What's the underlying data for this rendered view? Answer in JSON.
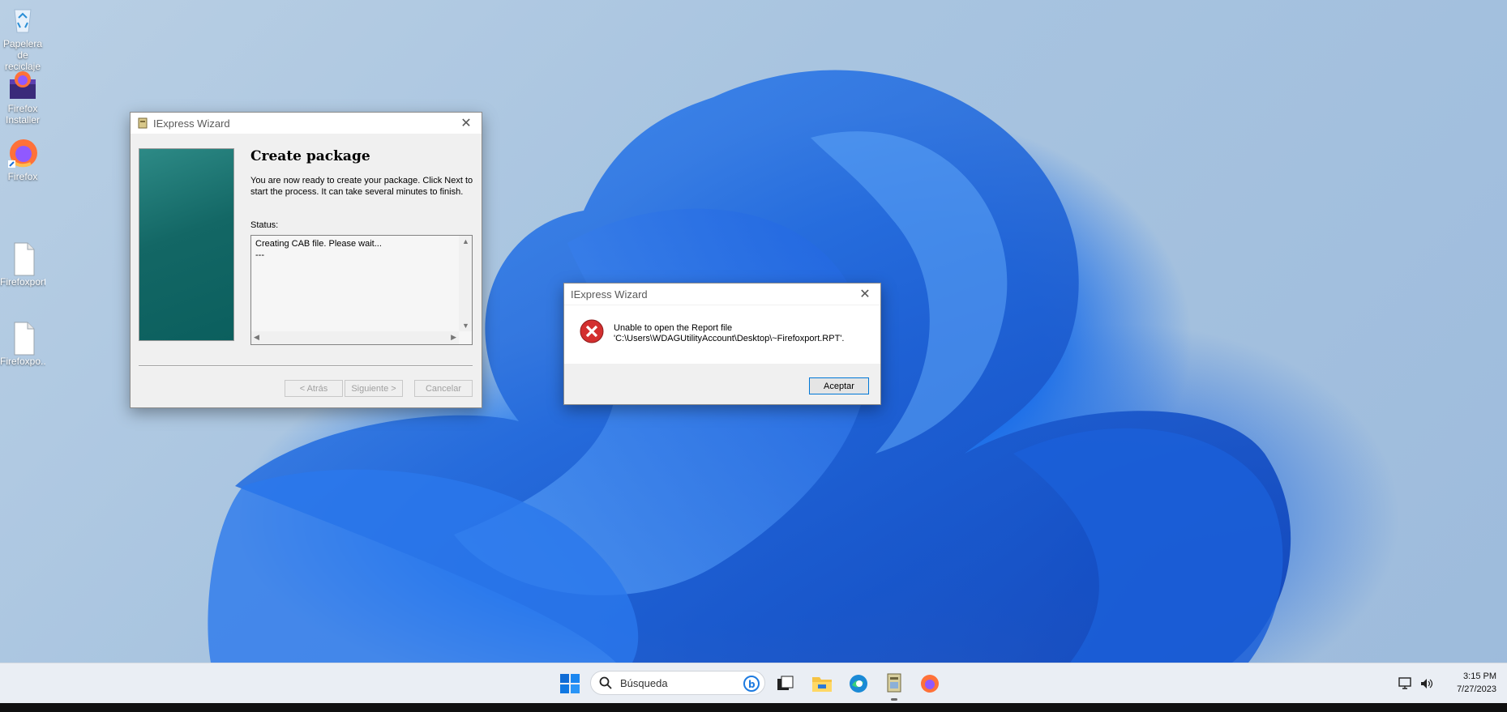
{
  "desktop": {
    "icons": [
      {
        "label": "Papelera de reciclaje"
      },
      {
        "label": "Firefox Installer"
      },
      {
        "label": "Firefox"
      },
      {
        "label": "Firefoxport...."
      },
      {
        "label": "Firefoxpo..."
      }
    ]
  },
  "wizard": {
    "title": "IExpress Wizard",
    "heading": "Create package",
    "description": "You are now ready to create your package.  Click Next to start the process.  It can take several minutes to finish.",
    "status_label": "Status:",
    "status_lines": [
      "Creating CAB file.  Please wait...",
      "---"
    ],
    "buttons": {
      "back": "< Atrás",
      "next": "Siguiente >",
      "cancel": "Cancelar"
    }
  },
  "error_dialog": {
    "title": "IExpress Wizard",
    "message_line1": "Unable to open the Report file",
    "message_line2": "'C:\\Users\\WDAGUtilityAccount\\Desktop\\~Firefoxport.RPT'.",
    "ok_button": "Aceptar"
  },
  "taskbar": {
    "search_placeholder": "Búsqueda",
    "time": "3:15 PM",
    "date": "7/27/2023"
  },
  "colors": {
    "taskbar_bg": "#eaeef4",
    "wizard_panel": "#1a6f6e",
    "error_red": "#d32f2f"
  }
}
